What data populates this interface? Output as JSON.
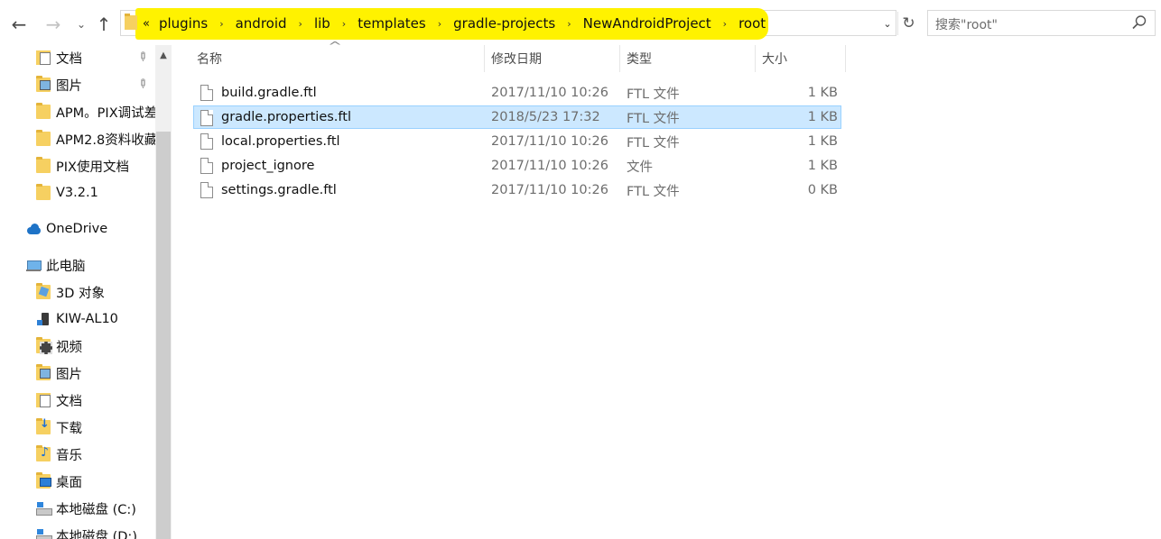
{
  "navigation": {
    "back_glyph": "←",
    "forward_glyph": "→",
    "recent_glyph": "⌄",
    "up_glyph": "↑"
  },
  "address_bar": {
    "overflow": "«",
    "separator": "›",
    "crumbs": [
      "plugins",
      "android",
      "lib",
      "templates",
      "gradle-projects",
      "NewAndroidProject",
      "root"
    ],
    "dropdown_glyph": "⌄",
    "refresh_glyph": "↻",
    "highlight_color": "#fff200"
  },
  "search": {
    "placeholder": "搜索\"root\""
  },
  "nav_pane": {
    "scroll_up_glyph": "▲",
    "pin_glyph": "📌",
    "items": [
      {
        "label": "文档",
        "icon": "documents-icon",
        "pinned": true
      },
      {
        "label": "图片",
        "icon": "pictures-icon",
        "pinned": true
      },
      {
        "label": "APM。PIX调试差",
        "icon": "folder-icon"
      },
      {
        "label": "APM2.8资料收藏",
        "icon": "folder-icon"
      },
      {
        "label": "PIX使用文档",
        "icon": "folder-icon"
      },
      {
        "label": "V3.2.1",
        "icon": "folder-icon"
      },
      {
        "label": "OneDrive",
        "icon": "onedrive-icon"
      },
      {
        "label": "此电脑",
        "icon": "this-pc-icon"
      },
      {
        "label": "3D 对象",
        "icon": "3d-objects-icon"
      },
      {
        "label": "KIW-AL10",
        "icon": "phone-icon"
      },
      {
        "label": "视频",
        "icon": "videos-icon"
      },
      {
        "label": "图片",
        "icon": "pictures-icon"
      },
      {
        "label": "文档",
        "icon": "documents-icon"
      },
      {
        "label": "下载",
        "icon": "downloads-icon"
      },
      {
        "label": "音乐",
        "icon": "music-icon"
      },
      {
        "label": "桌面",
        "icon": "desktop-icon"
      },
      {
        "label": "本地磁盘 (C:)",
        "icon": "drive-icon"
      },
      {
        "label": "本地磁盘 (D:)",
        "icon": "drive-icon"
      }
    ]
  },
  "file_list": {
    "sort_indicator": "^",
    "columns": {
      "name": "名称",
      "date": "修改日期",
      "type": "类型",
      "size": "大小"
    },
    "rows": [
      {
        "name": "build.gradle.ftl",
        "date": "2017/11/10 10:26",
        "type": "FTL 文件",
        "size": "1 KB"
      },
      {
        "name": "gradle.properties.ftl",
        "date": "2018/5/23 17:32",
        "type": "FTL 文件",
        "size": "1 KB",
        "selected": true
      },
      {
        "name": "local.properties.ftl",
        "date": "2017/11/10 10:26",
        "type": "FTL 文件",
        "size": "1 KB"
      },
      {
        "name": "project_ignore",
        "date": "2017/11/10 10:26",
        "type": "文件",
        "size": "1 KB"
      },
      {
        "name": "settings.gradle.ftl",
        "date": "2017/11/10 10:26",
        "type": "FTL 文件",
        "size": "0 KB"
      }
    ],
    "selection_color": "#cce8ff"
  }
}
